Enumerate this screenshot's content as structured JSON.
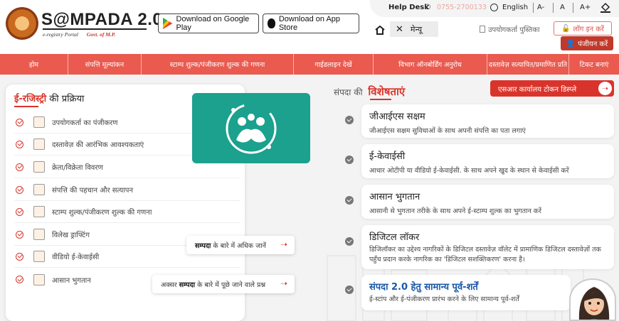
{
  "header": {
    "logo_title": "S@MPADA 2.0",
    "logo_sub": "e-registry Portal",
    "logo_gov": "Govt. of M.P.",
    "google_play": "Download on Google Play",
    "app_store": "Download on App Store",
    "helpdesk": "Help Desk",
    "phone": "0755-2700133",
    "language": "English",
    "font_decrease": "A-",
    "font_normal": "A",
    "font_increase": "A+",
    "menu": "मेन्यू",
    "manual": "उपयोगकर्ता पुस्तिका",
    "login": "लॉग इन करें",
    "register": "पंजीयन करें"
  },
  "nav": [
    "होम",
    "संपत्ति मूल्यांकन",
    "स्टाम्प शुल्क/पंजीकरण शुल्क की गणना",
    "गाईडलाइन देखें",
    "विभाग ऑनबोर्डिंग अनुरोध",
    "दस्तावेज़ सत्यापित/प्रमाणित प्रति",
    "टिकट बनाएं"
  ],
  "process": {
    "title_red": "ई-रजिस्ट्री",
    "title_rest": "की प्रक्रिया",
    "steps": [
      "उपयोगकर्ता का पंजीकरण",
      "दस्तावेज़ की आरंभिक आवश्यकताएं",
      "क्रेता/विक्रेता विवरण",
      "संपत्ति की पहचान और सत्यापन",
      "स्टाम्प शुल्क/पंजीकरण शुल्क की गणना",
      "विलेख ड्राफ्टिंग",
      "वीडियो ई-केवाईसी",
      "आसान भुगतान"
    ],
    "about_prefix": "",
    "about_bold": "सम्पदा",
    "about_suffix": " के बारे में अधिक जानें",
    "faq_prefix": "अक्सर ",
    "faq_bold": "सम्पदा",
    "faq_suffix": " के बारे में पूछे जाने वाले प्रश्न"
  },
  "features": {
    "head_prefix": "संपदा की",
    "head_red": "विशेषताएं",
    "token_button": "एसआर कार्यालय टोकन डिस्प्ले",
    "items": [
      {
        "title": "जीआईएस सक्षम",
        "desc": "जीआईएस सक्षम सुविधाओं के साथ अपनी संपत्ति का पता लगाएं"
      },
      {
        "title": "ई-केवाईसी",
        "desc": "आधार ओटीपी या वीडियो ई-केवाईसी. के साथ अपने खुद के स्थान से केवाईसी करें"
      },
      {
        "title": "आसान भुगतान",
        "desc": "आसानी से भुगतान तरीके के साथ अपने ई-स्टाम्प शुल्क का भुगतान करें"
      },
      {
        "title": "डिजिटल लॉकर",
        "desc": "डिजिलॉकर का उद्देश्य नागरिकों के डिजिटल दस्तावेज़ वॉलेट में प्रामाणिक डिजिटल दस्तावेज़ों तक पहुँच प्रदान करके नागरिक का 'डिजिटल सशक्तिकरण' करना है।"
      },
      {
        "title": "संपदा 2.0 हेतु सामान्य पूर्व-शर्तें",
        "desc": "ई-स्टांप और ई-पंजीकरण प्रारंभ करने के लिए सामान्य पूर्व-शर्तें"
      }
    ]
  },
  "colors": {
    "accent": "#ea5a4f",
    "brand_red": "#d9342b",
    "video_bg": "#1ba18e",
    "link_blue": "#1a58a8"
  }
}
